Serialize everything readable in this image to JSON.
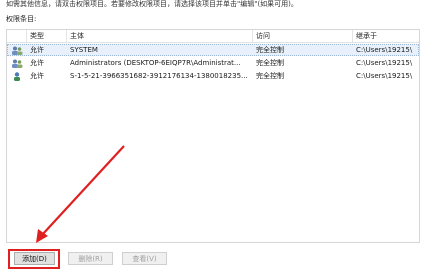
{
  "dialog": {
    "hint": "如需其他信息，请双击权限项目。若要修改权限项目，请选择该项目并单击\"编辑\"(如果可用)。",
    "list_caption": "权限条目:"
  },
  "table": {
    "columns": [
      "类型",
      "主体",
      "访问",
      "继承于"
    ],
    "rows": [
      {
        "icon": "users-group-icon",
        "type": "允许",
        "principal": "SYSTEM",
        "access": "完全控制",
        "inherited_from": "C:\\Users\\19215\\"
      },
      {
        "icon": "users-group-icon",
        "type": "允许",
        "principal": "Administrators (DESKTOP-6EIQP7R\\Administrat...",
        "access": "完全控制",
        "inherited_from": "C:\\Users\\19215\\"
      },
      {
        "icon": "user-icon",
        "type": "允许",
        "principal": "S-1-5-21-3966351682-3912176134-1380018235...",
        "access": "完全控制",
        "inherited_from": "C:\\Users\\19215\\"
      }
    ]
  },
  "buttons": {
    "add": "添加(D)",
    "remove": "删除(R)",
    "view": "查看(V)"
  },
  "colors": {
    "highlight": "#e02020",
    "selection": "#e8f1fb"
  }
}
